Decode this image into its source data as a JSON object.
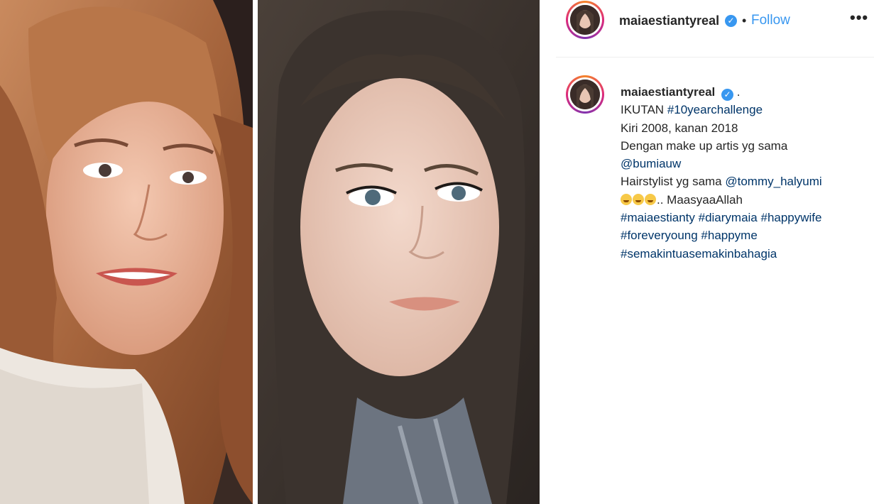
{
  "post": {
    "username": "maiaestiantyreal",
    "follow_label": "Follow",
    "separator": "•",
    "more_label": "•••",
    "verified_symbol": "✓",
    "caption_dot": ".",
    "caption_lines": [
      {
        "prefix": "IKUTAN ",
        "tag": "#10yearchallenge"
      },
      {
        "text": "Kiri 2008, kanan 2018"
      },
      {
        "text": "Dengan make up artis yg sama"
      },
      {
        "mention": "@bumiauw"
      },
      {
        "prefix": "Hairstylist yg sama ",
        "mention": "@tommy_halyumi"
      },
      {
        "emoji": "😂😂😂",
        "text": ".. MaasyaaAllah"
      },
      {
        "tags": "#maiaestianty #diarymaia #happywife"
      },
      {
        "tags": "#foreveryoung #happyme"
      },
      {
        "tags": "#semakintuasemakinbahagia"
      }
    ]
  },
  "colors": {
    "accent_blue": "#3897f0",
    "link": "#003569",
    "text": "#262626",
    "border": "#efefef"
  },
  "icons": {
    "verified": "verified-badge-icon",
    "more": "more-options-icon"
  }
}
